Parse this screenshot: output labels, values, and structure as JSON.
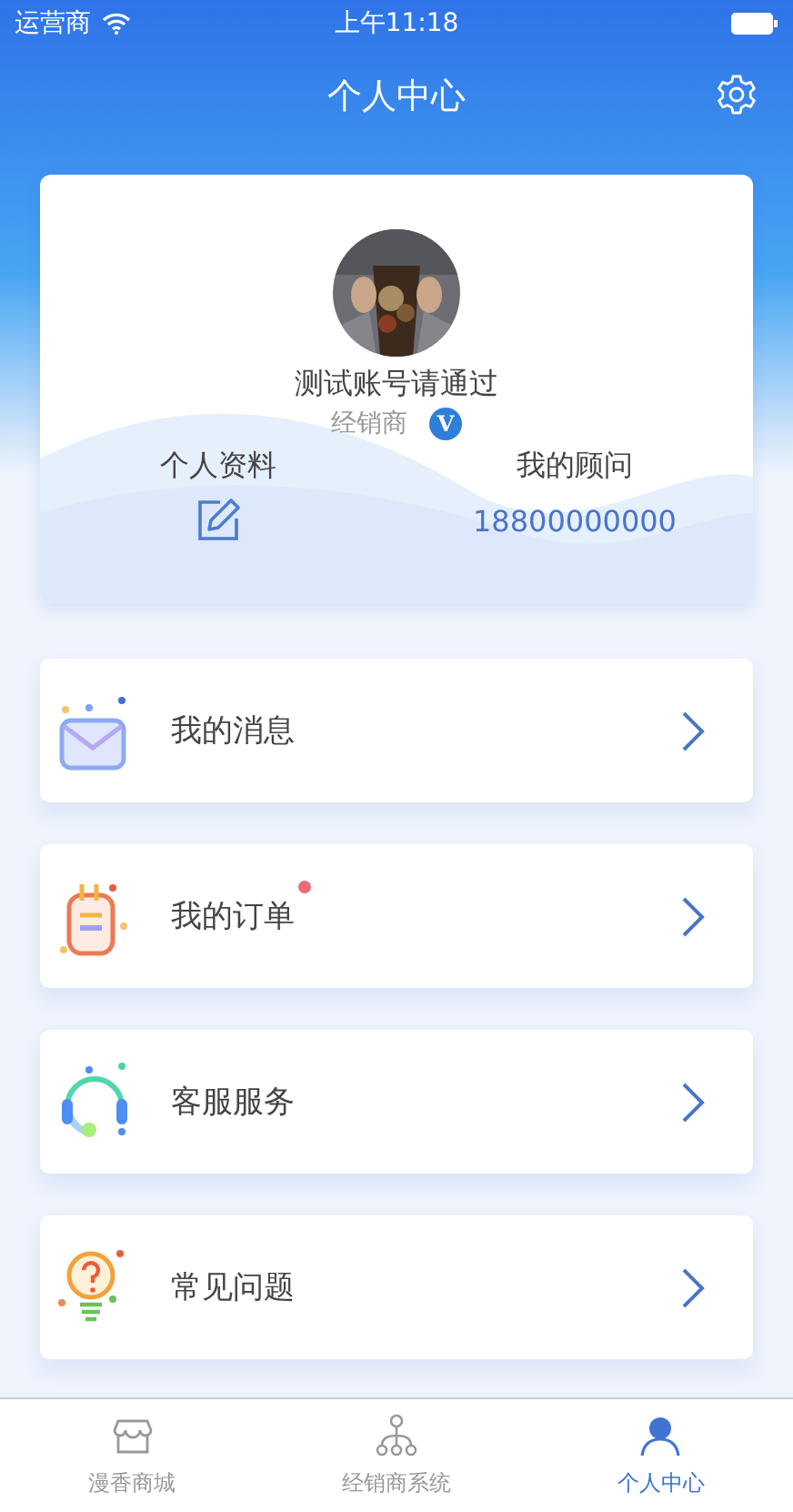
{
  "status_bar": {
    "carrier": "运营商",
    "time": "上午11:18"
  },
  "header": {
    "title": "个人中心"
  },
  "profile": {
    "name": "测试账号请通过",
    "role": "经销商",
    "verified_mark": "V",
    "profile_link": "个人资料",
    "advisor_label": "我的顾问",
    "advisor_phone": "18800000000"
  },
  "menu": [
    {
      "kind": "message",
      "label": "我的消息",
      "dot": false
    },
    {
      "kind": "order",
      "label": "我的订单",
      "dot": true
    },
    {
      "kind": "service",
      "label": "客服服务",
      "dot": false
    },
    {
      "kind": "faq",
      "label": "常见问题",
      "dot": false
    }
  ],
  "tabs": [
    {
      "kind": "shop",
      "label": "漫香商城",
      "selected": false
    },
    {
      "kind": "network",
      "label": "经销商系统",
      "selected": false
    },
    {
      "kind": "person",
      "label": "个人中心",
      "selected": true
    }
  ]
}
